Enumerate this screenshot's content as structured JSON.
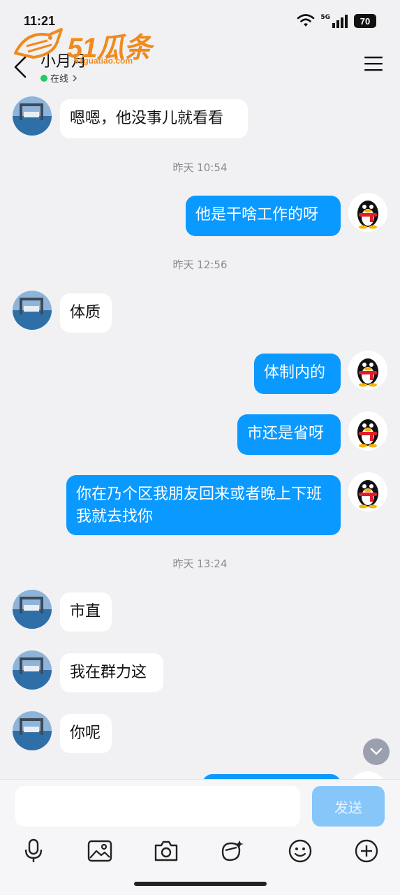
{
  "status_bar": {
    "time": "11:21",
    "network": "5G",
    "battery": "70"
  },
  "watermark": {
    "brand": "51瓜条",
    "url": "51guatiao.com"
  },
  "header": {
    "contact_name": "小月月",
    "status_label": "在线"
  },
  "messages": [
    {
      "side": "in",
      "text": "嗯嗯，他没事儿就看看"
    },
    {
      "type": "time",
      "text": "昨天 10:54"
    },
    {
      "side": "out",
      "text": "他是干啥工作的呀"
    },
    {
      "type": "time",
      "text": "昨天 12:56"
    },
    {
      "side": "in",
      "text": "体质"
    },
    {
      "side": "out",
      "text": "体制内的"
    },
    {
      "side": "out",
      "text": "市还是省呀"
    },
    {
      "side": "out",
      "text": "你在乃个区我朋友回来或者晚上下班我就去找你"
    },
    {
      "type": "time",
      "text": "昨天 13:24"
    },
    {
      "side": "in",
      "text": "市直"
    },
    {
      "side": "in",
      "text": "我在群力这"
    },
    {
      "side": "in",
      "text": "你呢"
    }
  ],
  "composer": {
    "input_value": "",
    "send_label": "发送"
  },
  "toolbar": {
    "icons": [
      "microphone-icon",
      "image-icon",
      "camera-icon",
      "sticker-icon",
      "emoji-icon",
      "plus-icon"
    ]
  },
  "colors": {
    "outgoing_bubble": "#0a99ff",
    "incoming_bubble": "#ffffff",
    "online_dot": "#1fcb63",
    "send_button": "#87c6f9"
  }
}
